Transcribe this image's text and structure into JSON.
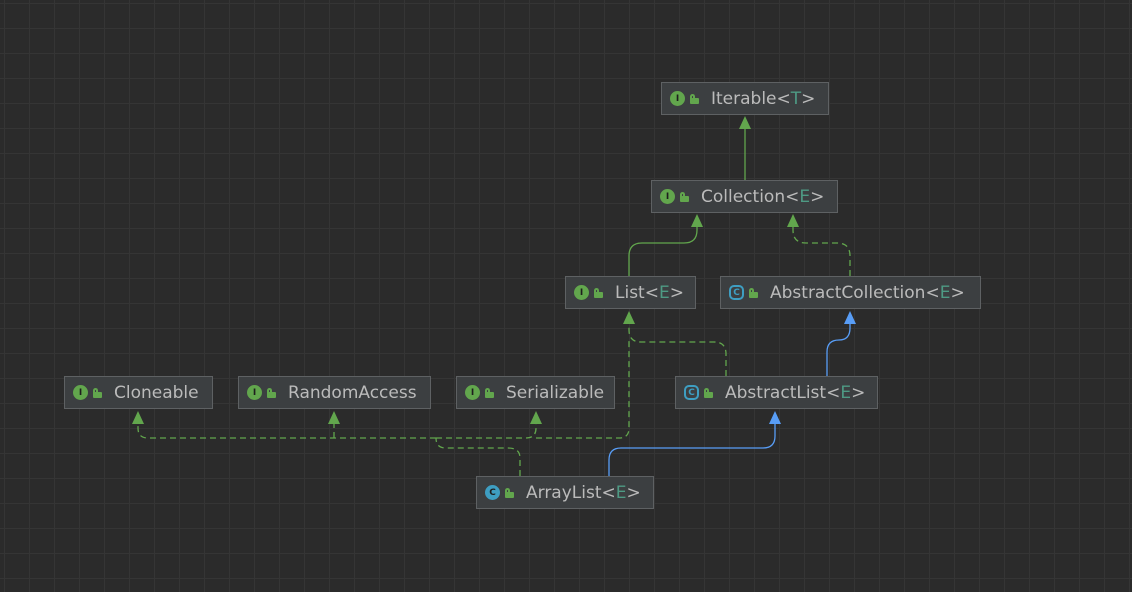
{
  "nodes": {
    "iterable": {
      "name": "Iterable",
      "lt": "<",
      "param": "T",
      "gt": ">",
      "kind": "I"
    },
    "collection": {
      "name": "Collection",
      "lt": "<",
      "param": "E",
      "gt": ">",
      "kind": "I"
    },
    "list": {
      "name": "List",
      "lt": "<",
      "param": "E",
      "gt": ">",
      "kind": "I"
    },
    "abstract_collection": {
      "name": "AbstractCollection",
      "lt": "<",
      "param": "E",
      "gt": ">",
      "kind": "C"
    },
    "cloneable": {
      "name": "Cloneable",
      "kind": "I"
    },
    "random_access": {
      "name": "RandomAccess",
      "kind": "I"
    },
    "serializable": {
      "name": "Serializable",
      "kind": "I"
    },
    "abstract_list": {
      "name": "AbstractList",
      "lt": "<",
      "param": "E",
      "gt": ">",
      "kind": "C"
    },
    "array_list": {
      "name": "ArrayList",
      "lt": "<",
      "param": "E",
      "gt": ">",
      "kind": "C"
    }
  },
  "colors": {
    "background": "#2b2b2b",
    "grid": "#353535",
    "node_fill": "#3c3f41",
    "node_border": "#5e6163",
    "interface_icon": "#62a64d",
    "class_icon": "#3e9ec2",
    "extends_interface_edge": "#62a64d",
    "implements_edge": "#62a64d",
    "extends_class_edge": "#589df6",
    "type_param": "#4e9a84"
  }
}
